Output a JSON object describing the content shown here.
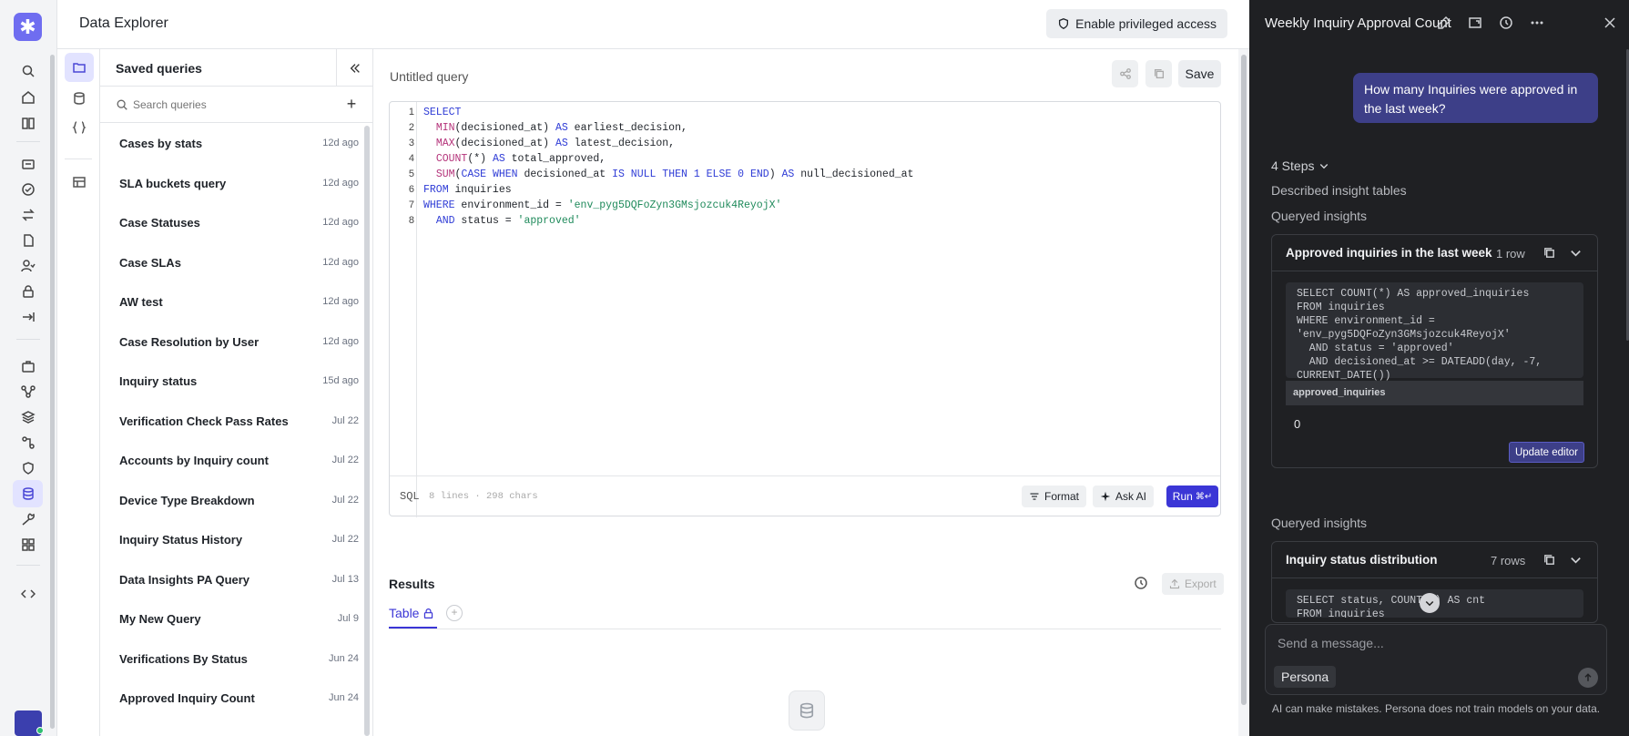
{
  "app": {
    "logo": "asterisk-logo",
    "page_title": "Data Explorer",
    "privileged_button": "Enable privileged access"
  },
  "rail_icons": [
    "search-icon",
    "home-icon",
    "book-icon",
    "id-card-icon",
    "check-circle-icon",
    "swap-icon",
    "document-icon",
    "user-check-icon",
    "lock-icon",
    "arrow-in-icon",
    "briefcase-icon",
    "graph-icon",
    "layers-icon",
    "workflow-icon",
    "shield-icon",
    "database-icon",
    "wrench-icon",
    "grid-icon",
    "code-icon"
  ],
  "saved": {
    "title": "Saved queries",
    "search_placeholder": "Search queries",
    "items": [
      {
        "name": "Cases by stats",
        "date": "12d ago"
      },
      {
        "name": "SLA buckets query",
        "date": "12d ago"
      },
      {
        "name": "Case Statuses",
        "date": "12d ago"
      },
      {
        "name": "Case SLAs",
        "date": "12d ago"
      },
      {
        "name": "AW test",
        "date": "12d ago"
      },
      {
        "name": "Case Resolution by User",
        "date": "12d ago"
      },
      {
        "name": "Inquiry status",
        "date": "15d ago"
      },
      {
        "name": "Verification Check Pass Rates",
        "date": "Jul 22"
      },
      {
        "name": "Accounts by Inquiry count",
        "date": "Jul 22"
      },
      {
        "name": "Device Type Breakdown",
        "date": "Jul 22"
      },
      {
        "name": "Inquiry Status History",
        "date": "Jul 22"
      },
      {
        "name": "Data Insights PA Query",
        "date": "Jul 13"
      },
      {
        "name": "My New Query",
        "date": "Jul 9"
      },
      {
        "name": "Verifications By Status",
        "date": "Jun 24"
      },
      {
        "name": "Approved Inquiry Count",
        "date": "Jun 24"
      }
    ]
  },
  "editor": {
    "query_title": "Untitled query",
    "save_label": "Save",
    "language": "SQL",
    "stats": "8 lines · 298 chars",
    "format_label": "Format",
    "ask_ai_label": "Ask AI",
    "run_label": "Run",
    "run_shortcut": "⌘↵",
    "line_numbers": [
      "1",
      "2",
      "3",
      "4",
      "5",
      "6",
      "7",
      "8"
    ]
  },
  "results": {
    "title": "Results",
    "export_label": "Export",
    "tab_table": "Table"
  },
  "ai": {
    "title": "Weekly Inquiry Approval Count",
    "user_message": "How many Inquiries were approved in the last week?",
    "steps_label": "4 Steps",
    "step1": "Described insight tables",
    "step2": "Queryed insights",
    "card1": {
      "title": "Approved inquiries in the last week",
      "rows": "1 row",
      "sql": "SELECT COUNT(*) AS approved_inquiries\nFROM inquiries\nWHERE environment_id =\n'env_pyg5DQFoZyn3GMsjozcuk4ReyojX'\n  AND status = 'approved'\n  AND decisioned_at >= DATEADD(day, -7,\nCURRENT_DATE())",
      "column": "approved_inquiries",
      "value": "0",
      "update_label": "Update editor"
    },
    "step3": "Queryed insights",
    "card2": {
      "title": "Inquiry status distribution",
      "rows": "7 rows",
      "sql": "SELECT status, COUNT(*) AS cnt\nFROM inquiries"
    },
    "composer_placeholder": "Send a message...",
    "persona_label": "Persona",
    "disclaimer": "AI can make mistakes. Persona does not train models on your data."
  },
  "colors": {
    "accent": "#3b36d6",
    "logo": "#6f6df0",
    "ai_bg": "#1f2023",
    "bubble": "#3d3f88"
  }
}
